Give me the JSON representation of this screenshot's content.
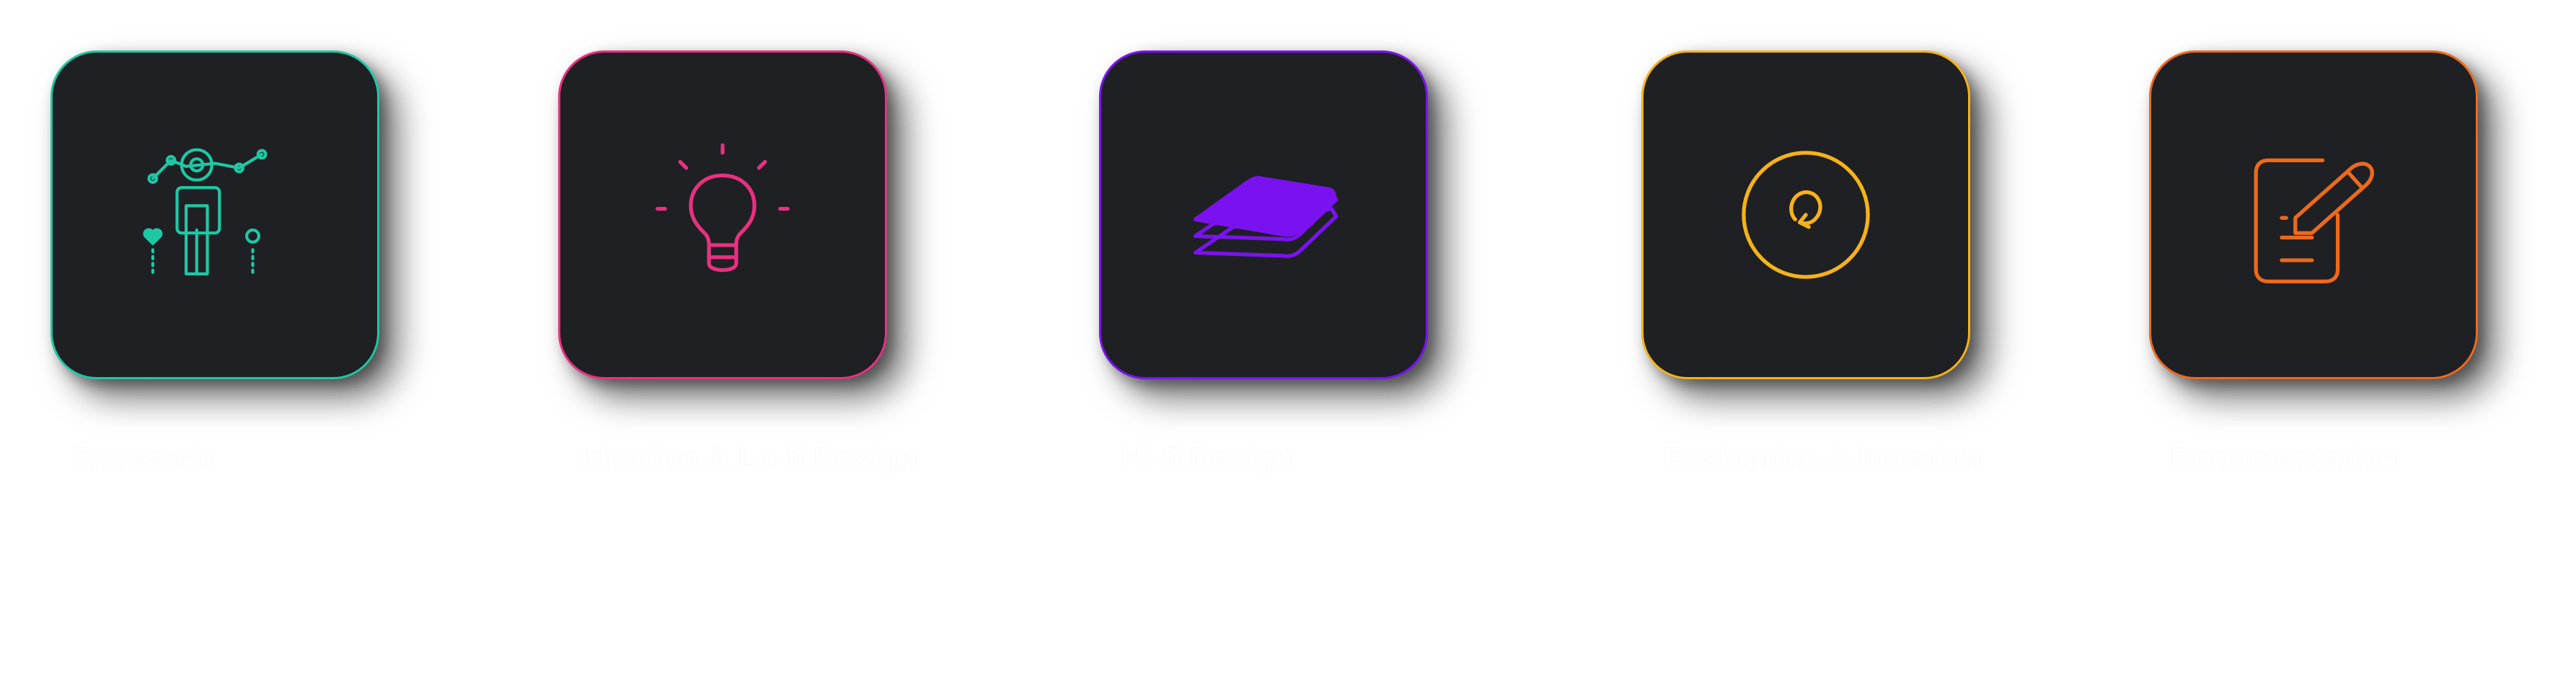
{
  "steps": [
    {
      "label": "Research",
      "icon": "research-icon",
      "accent": "#1ec8a5"
    },
    {
      "label": "Ideation & Lo-fi Design",
      "icon": "lightbulb-icon",
      "accent": "#e8317f"
    },
    {
      "label": "Hi-fi Design",
      "icon": "layers-icon",
      "accent": "#7a12f0"
    },
    {
      "label": "Evaluation & Iteration",
      "icon": "iteration-icon",
      "accent": "#f5b21a"
    },
    {
      "label": "Documentation",
      "icon": "document-edit-icon",
      "accent": "#ec6a1c"
    }
  ]
}
